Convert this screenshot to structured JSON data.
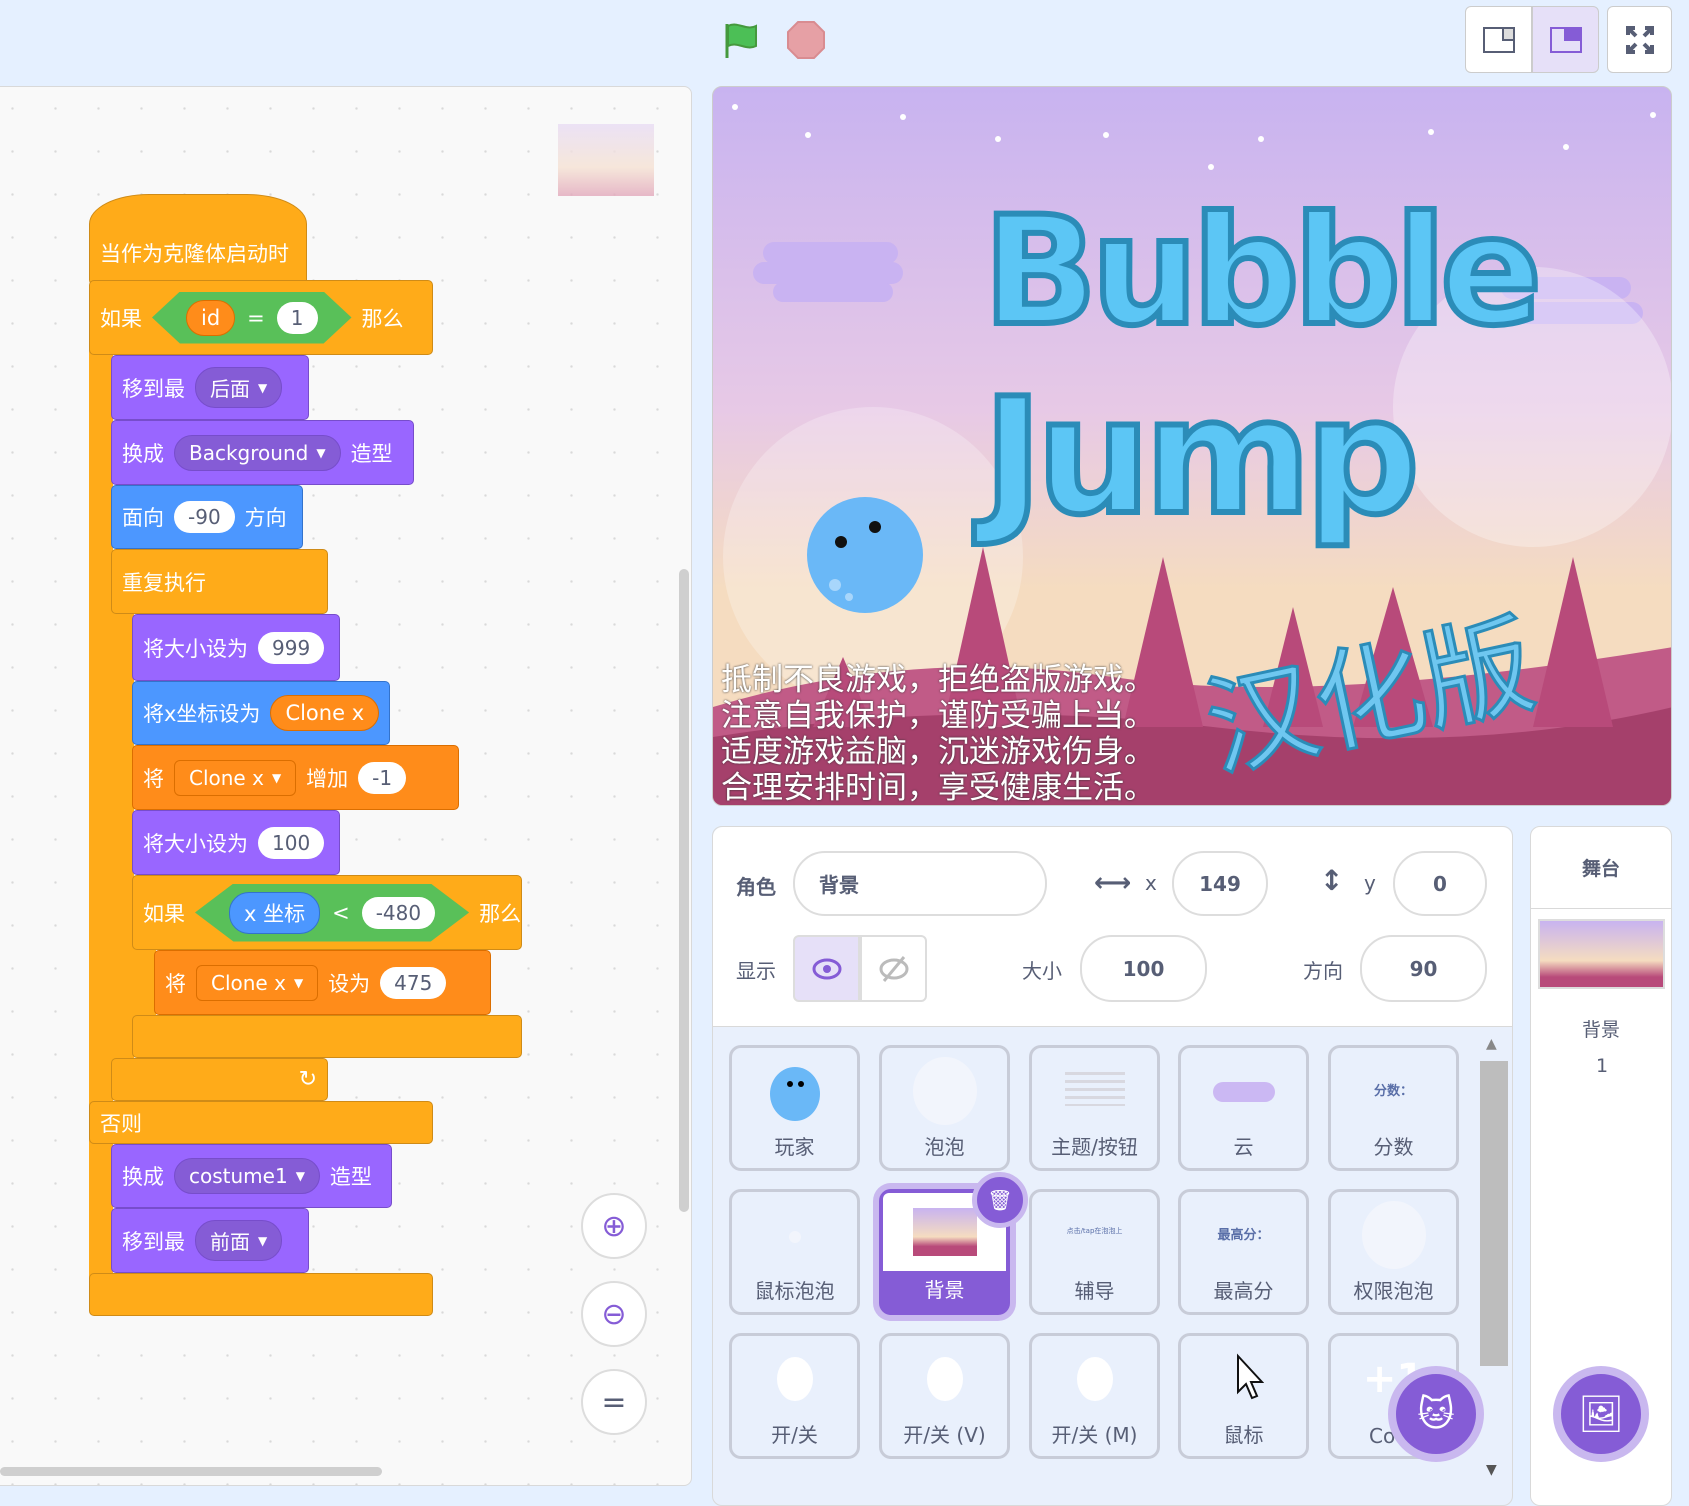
{
  "header": {
    "green_flag": "green-flag-icon",
    "stop": "stop-icon",
    "layout_small": "small-stage-icon",
    "layout_normal": "normal-stage-icon",
    "fullscreen": "fullscreen-icon"
  },
  "colors": {
    "control": "#ffab19",
    "looks": "#9966ff",
    "motion": "#4c97ff",
    "variables": "#ff8c1a",
    "operators": "#59c059",
    "accent": "#855cd6"
  },
  "script": {
    "hat": "当作为克隆体启动时",
    "if1": {
      "label": "如果",
      "var": "id",
      "op": "=",
      "value": "1",
      "then": "那么"
    },
    "go_back": {
      "label": "移到最",
      "option": "后面"
    },
    "switch_costume": {
      "label": "换成",
      "option": "Background",
      "suffix": "造型"
    },
    "point": {
      "label": "面向",
      "value": "-90",
      "suffix": "方向"
    },
    "forever": "重复执行",
    "set_size1": {
      "label": "将大小设为",
      "value": "999"
    },
    "set_x": {
      "label": "将x坐标设为",
      "value": "Clone x"
    },
    "change_var": {
      "label": "将",
      "var": "Clone x",
      "mid": "增加",
      "value": "-1"
    },
    "set_size2": {
      "label": "将大小设为",
      "value": "100"
    },
    "if2": {
      "label": "如果",
      "reporter": "x 坐标",
      "op": "<",
      "value": "-480",
      "then": "那么"
    },
    "set_var": {
      "label": "将",
      "var": "Clone x",
      "mid": "设为",
      "value": "475"
    },
    "else": "否则",
    "switch_costume2": {
      "label": "换成",
      "option": "costume1",
      "suffix": "造型"
    },
    "go_front": {
      "label": "移到最",
      "option": "前面"
    }
  },
  "stage": {
    "title1": "Bubble",
    "title2": "Jump",
    "subtitle": "汉化版",
    "notice": [
      "抵制不良游戏，拒绝盗版游戏。",
      "注意自我保护，谨防受骗上当。",
      "适度游戏益脑，沉迷游戏伤身。",
      "合理安排时间，享受健康生活。"
    ]
  },
  "sprite_info": {
    "sprite_label": "角色",
    "sprite_name": "背景",
    "x_label": "x",
    "x": "149",
    "y_label": "y",
    "y": "0",
    "show_label": "显示",
    "size_label": "大小",
    "size": "100",
    "direction_label": "方向",
    "direction": "90"
  },
  "sprites": [
    {
      "name": "玩家"
    },
    {
      "name": "泡泡"
    },
    {
      "name": "主题/按钮"
    },
    {
      "name": "云"
    },
    {
      "name": "分数",
      "thumb_text": "分数："
    },
    {
      "name": "鼠标泡泡"
    },
    {
      "name": "背景",
      "selected": true
    },
    {
      "name": "辅导",
      "thumb_text": "点击/tap在泡泡上"
    },
    {
      "name": "最高分",
      "thumb_text": "最高分："
    },
    {
      "name": "权限泡泡"
    },
    {
      "name": "开/关"
    },
    {
      "name": "开/关 (V)"
    },
    {
      "name": "开/关 (M)"
    },
    {
      "name": "鼠标"
    },
    {
      "name": "Co"
    }
  ],
  "stage_panel": {
    "title": "舞台",
    "backdrop_label": "背景",
    "backdrop_count": "1"
  }
}
